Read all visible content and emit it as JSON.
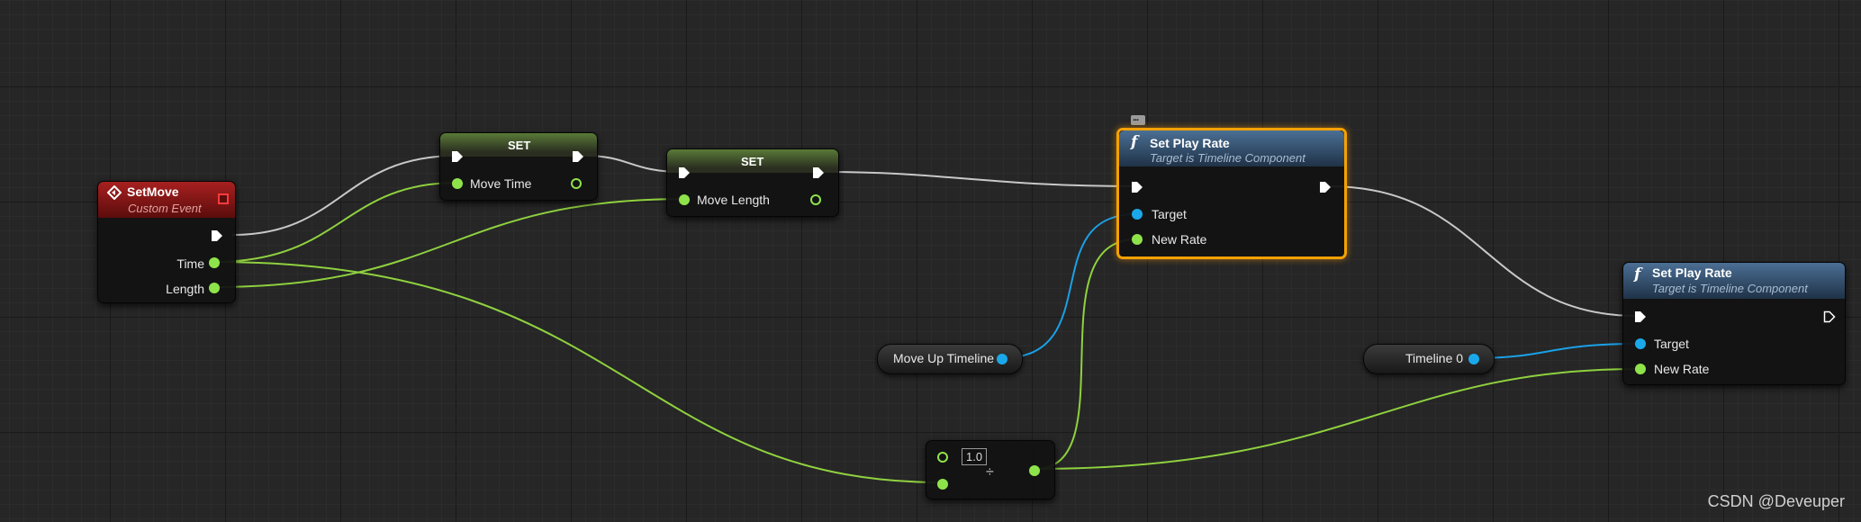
{
  "nodes": {
    "setmove": {
      "title": "SetMove",
      "subtitle": "Custom Event",
      "pins": [
        "Time",
        "Length"
      ]
    },
    "set_time": {
      "title": "SET",
      "pin": "Move Time"
    },
    "set_length": {
      "title": "SET",
      "pin": "Move Length"
    },
    "set_play_rate_1": {
      "title": "Set Play Rate",
      "subtitle": "Target is Timeline Component",
      "pins": [
        "Target",
        "New Rate"
      ]
    },
    "set_play_rate_2": {
      "title": "Set Play Rate",
      "subtitle": "Target is Timeline Component",
      "pins": [
        "Target",
        "New Rate"
      ]
    },
    "move_up_timeline": {
      "label": "Move Up Timeline"
    },
    "timeline_0": {
      "label": "Timeline 0"
    },
    "divide": {
      "value": "1.0",
      "operator": "÷"
    }
  },
  "icons": {
    "event": "event-diamond-icon",
    "function": "function-icon",
    "comment": "comment-bubble-icon"
  },
  "colors": {
    "exec_wire": "#c8c8c8",
    "float_wire": "#8fd13f",
    "object_wire": "#1aa0e6",
    "selected_outline": "#f5a100",
    "event_header": "#a82020",
    "function_header": "#4b6f94"
  },
  "watermark": "CSDN @Deveuper"
}
